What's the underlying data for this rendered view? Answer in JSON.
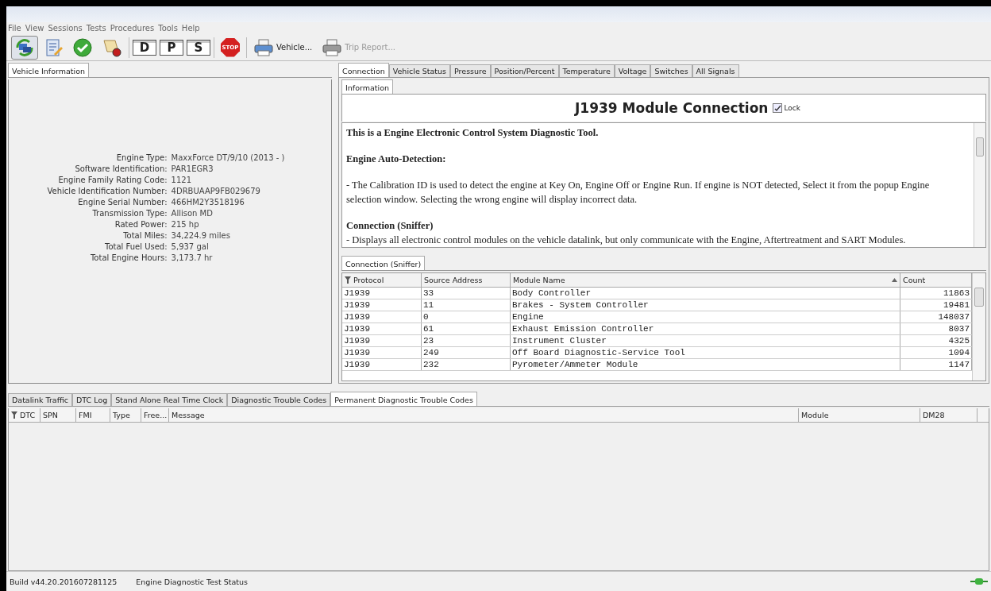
{
  "menu": [
    "File",
    "View",
    "Sessions",
    "Tests",
    "Procedures",
    "Tools",
    "Help"
  ],
  "toolbar": [
    {
      "kind": "connect",
      "selected": true
    },
    {
      "kind": "notes"
    },
    {
      "kind": "check"
    },
    {
      "kind": "scroll"
    },
    {
      "kind": "sep"
    },
    {
      "kind": "letter",
      "label": "D"
    },
    {
      "kind": "letter",
      "label": "P"
    },
    {
      "kind": "letter",
      "label": "S"
    },
    {
      "kind": "sep"
    },
    {
      "kind": "stop",
      "label": "STOP"
    },
    {
      "kind": "sep"
    },
    {
      "kind": "printer",
      "label": "Vehicle...",
      "disabled": false
    },
    {
      "kind": "printer",
      "label": "Trip Report...",
      "disabled": true
    }
  ],
  "left_panel": {
    "tab": "Vehicle Information",
    "fields": [
      {
        "label": "Engine Type:",
        "value": "MaxxForce DT/9/10 (2013 - )"
      },
      {
        "label": "Software Identification:",
        "value": "PAR1EGR3"
      },
      {
        "label": "Engine Family Rating Code:",
        "value": "1121"
      },
      {
        "label": "Vehicle Identification Number:",
        "value": "4DRBUAAP9FB029679"
      },
      {
        "label": "Engine Serial Number:",
        "value": "466HM2Y3518196"
      },
      {
        "label": "Transmission Type:",
        "value": "Allison MD"
      },
      {
        "label": "Rated Power:",
        "value": "215 hp"
      },
      {
        "label": "Total Miles:",
        "value": "34,224.9 miles"
      },
      {
        "label": "Total Fuel Used:",
        "value": "5,937 gal"
      },
      {
        "label": "Total Engine Hours:",
        "value": "3,173.7 hr"
      }
    ]
  },
  "right_tabs": [
    {
      "label": "Connection",
      "selected": true
    },
    {
      "label": "Vehicle Status",
      "selected": false
    },
    {
      "label": "Pressure",
      "selected": false
    },
    {
      "label": "Position/Percent",
      "selected": false
    },
    {
      "label": "Temperature",
      "selected": false
    },
    {
      "label": "Voltage",
      "selected": false
    },
    {
      "label": "Switches",
      "selected": false
    },
    {
      "label": "All Signals",
      "selected": false
    }
  ],
  "info": {
    "tab": "Information",
    "title": "J1939 Module Connection",
    "lock": {
      "label": "Lock",
      "checked": true
    },
    "paragraphs": [
      {
        "kind": "heading",
        "text": "This is a Engine Electronic Control System Diagnostic Tool."
      },
      {
        "kind": "heading",
        "text": "Engine Auto-Detection:"
      },
      {
        "kind": "text",
        "text": "- The Calibration ID is used to detect the engine at Key On, Engine Off or Engine Run. If engine is NOT detected, Select it from the popup Engine selection window. Selecting the wrong engine will display incorrect data."
      },
      {
        "kind": "heading",
        "text": "Connection (Sniffer)"
      },
      {
        "kind": "text",
        "text": "- Displays all electronic control modules on the vehicle datalink, but only communicate with the Engine, Aftertreatment and SART Modules."
      }
    ]
  },
  "sniffer": {
    "tab": "Connection (Sniffer)",
    "columns": [
      "Protocol",
      "Source Address",
      "Module Name",
      "Count"
    ],
    "rows": [
      [
        "J1939",
        "33",
        "Body Controller",
        "11863"
      ],
      [
        "J1939",
        "11",
        "Brakes - System Controller",
        "19481"
      ],
      [
        "J1939",
        "0",
        "Engine",
        "148037"
      ],
      [
        "J1939",
        "61",
        "Exhaust Emission Controller",
        "8037"
      ],
      [
        "J1939",
        "23",
        "Instrument Cluster",
        "4325"
      ],
      [
        "J1939",
        "249",
        "Off Board Diagnostic-Service Tool",
        "1094"
      ],
      [
        "J1939",
        "232",
        "Pyrometer/Ammeter Module",
        "1147"
      ]
    ]
  },
  "bottom_tabs": [
    {
      "label": "Datalink Traffic",
      "selected": false
    },
    {
      "label": "DTC Log",
      "selected": false
    },
    {
      "label": "Stand Alone Real Time Clock",
      "selected": false
    },
    {
      "label": "Diagnostic Trouble Codes",
      "selected": false
    },
    {
      "label": "Permanent Diagnostic Trouble Codes",
      "selected": true
    }
  ],
  "dtc_columns": [
    "DTC",
    "SPN",
    "FMI",
    "Type",
    "Free...",
    "Message",
    "Module",
    "DM28"
  ],
  "status_bar": {
    "build": "Build v44.20.201607281125",
    "status": "Engine Diagnostic Test Status"
  }
}
